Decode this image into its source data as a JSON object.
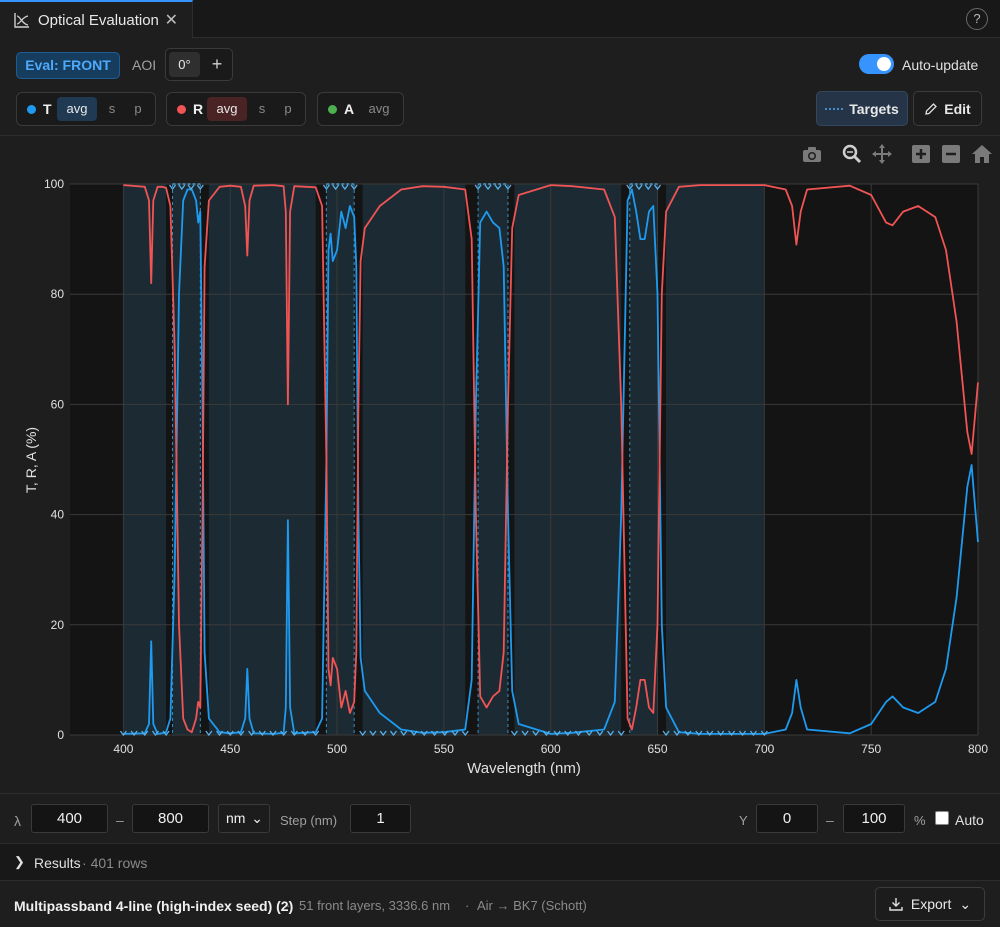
{
  "tab": {
    "title": "Optical Evaluation",
    "close_label": "✕",
    "help_label": "?"
  },
  "toolbar": {
    "eval_label": "Eval: FRONT",
    "aoi_label": "AOI",
    "aoi_value": "0°",
    "aoi_add": "+",
    "auto_update_label": "Auto-update",
    "auto_update_on": true,
    "targets_label": "Targets",
    "edit_label": "Edit"
  },
  "series_groups": [
    {
      "name": "T",
      "color": "#1e9bf0",
      "options": [
        "avg",
        "s",
        "p"
      ],
      "selected": "avg"
    },
    {
      "name": "R",
      "color": "#f05454",
      "options": [
        "avg",
        "s",
        "p"
      ],
      "selected": "avg"
    },
    {
      "name": "A",
      "color": "#4caf50",
      "options": [
        "avg"
      ],
      "selected": "avg"
    }
  ],
  "modebar": [
    "camera-icon",
    "zoom-icon",
    "pan-icon",
    "zoom-in-icon",
    "zoom-out-icon",
    "home-icon"
  ],
  "chart_data": {
    "type": "line",
    "xlabel": "Wavelength (nm)",
    "ylabel": "T, R, A (%)",
    "xlim": [
      375,
      800
    ],
    "ylim": [
      0,
      100
    ],
    "xticks": [
      400,
      450,
      500,
      550,
      600,
      650,
      700,
      750,
      800
    ],
    "yticks": [
      0,
      20,
      40,
      60,
      80,
      100
    ],
    "grid": true,
    "target_regions": [
      {
        "x0": 400,
        "x1": 420,
        "type": "stop"
      },
      {
        "x0": 423,
        "x1": 436,
        "type": "pass"
      },
      {
        "x0": 440,
        "x1": 490,
        "type": "stop"
      },
      {
        "x0": 495,
        "x1": 508,
        "type": "pass"
      },
      {
        "x0": 512,
        "x1": 560,
        "type": "stop"
      },
      {
        "x0": 566,
        "x1": 580,
        "type": "pass"
      },
      {
        "x0": 583,
        "x1": 633,
        "type": "stop"
      },
      {
        "x0": 637,
        "x1": 650,
        "type": "pass"
      },
      {
        "x0": 654,
        "x1": 700,
        "type": "stop"
      }
    ],
    "series": [
      {
        "name": "T",
        "color": "#1e9bf0",
        "points": [
          [
            400,
            0.2
          ],
          [
            410,
            0.3
          ],
          [
            412,
            2
          ],
          [
            413,
            17
          ],
          [
            414,
            2
          ],
          [
            416,
            0.2
          ],
          [
            418,
            0.3
          ],
          [
            420,
            0.5
          ],
          [
            422,
            3
          ],
          [
            424,
            30
          ],
          [
            426,
            80
          ],
          [
            428,
            97
          ],
          [
            430,
            99
          ],
          [
            432,
            99
          ],
          [
            434,
            97
          ],
          [
            435,
            93
          ],
          [
            436,
            95
          ],
          [
            437,
            60
          ],
          [
            438,
            15
          ],
          [
            440,
            3
          ],
          [
            445,
            0.5
          ],
          [
            450,
            0.3
          ],
          [
            455,
            0.5
          ],
          [
            457,
            3
          ],
          [
            458,
            12
          ],
          [
            459,
            3
          ],
          [
            461,
            0.3
          ],
          [
            470,
            0.2
          ],
          [
            475,
            0.4
          ],
          [
            476,
            5
          ],
          [
            477,
            39
          ],
          [
            478,
            5
          ],
          [
            480,
            0.3
          ],
          [
            490,
            0.5
          ],
          [
            493,
            3
          ],
          [
            495,
            50
          ],
          [
            496,
            88
          ],
          [
            497,
            91
          ],
          [
            498,
            86
          ],
          [
            500,
            88
          ],
          [
            502,
            95
          ],
          [
            504,
            92
          ],
          [
            506,
            96
          ],
          [
            508,
            94
          ],
          [
            509,
            85
          ],
          [
            510,
            40
          ],
          [
            511,
            14
          ],
          [
            513,
            8
          ],
          [
            520,
            4
          ],
          [
            530,
            1
          ],
          [
            540,
            0.4
          ],
          [
            550,
            0.5
          ],
          [
            560,
            1
          ],
          [
            563,
            10
          ],
          [
            565,
            60
          ],
          [
            567,
            93
          ],
          [
            570,
            95
          ],
          [
            573,
            93
          ],
          [
            576,
            92
          ],
          [
            578,
            85
          ],
          [
            580,
            40
          ],
          [
            582,
            8
          ],
          [
            585,
            2
          ],
          [
            600,
            0.2
          ],
          [
            610,
            0.4
          ],
          [
            625,
            1
          ],
          [
            630,
            6
          ],
          [
            633,
            40
          ],
          [
            636,
            97
          ],
          [
            638,
            99
          ],
          [
            640,
            95
          ],
          [
            642,
            90
          ],
          [
            644,
            90
          ],
          [
            646,
            95
          ],
          [
            648,
            96
          ],
          [
            650,
            80
          ],
          [
            652,
            20
          ],
          [
            654,
            5
          ],
          [
            660,
            0.5
          ],
          [
            670,
            0.2
          ],
          [
            700,
            0.2
          ],
          [
            710,
            1
          ],
          [
            713,
            4
          ],
          [
            715,
            10
          ],
          [
            717,
            5
          ],
          [
            720,
            1
          ],
          [
            740,
            0.3
          ],
          [
            750,
            2
          ],
          [
            757,
            6
          ],
          [
            760,
            7
          ],
          [
            765,
            5
          ],
          [
            772,
            4
          ],
          [
            780,
            6
          ],
          [
            785,
            12
          ],
          [
            790,
            25
          ],
          [
            795,
            45
          ],
          [
            797,
            49
          ],
          [
            800,
            35
          ]
        ]
      },
      {
        "name": "R",
        "color": "#f05454",
        "points": [
          [
            400,
            99.8
          ],
          [
            410,
            99.5
          ],
          [
            412,
            97
          ],
          [
            413,
            82
          ],
          [
            414,
            97
          ],
          [
            416,
            99.5
          ],
          [
            418,
            99.5
          ],
          [
            420,
            99.3
          ],
          [
            422,
            96
          ],
          [
            424,
            70
          ],
          [
            426,
            20
          ],
          [
            428,
            3
          ],
          [
            430,
            1
          ],
          [
            432,
            0.5
          ],
          [
            434,
            3
          ],
          [
            435,
            6
          ],
          [
            436,
            5
          ],
          [
            437,
            40
          ],
          [
            438,
            85
          ],
          [
            440,
            97
          ],
          [
            445,
            99.5
          ],
          [
            450,
            99.7
          ],
          [
            455,
            99.5
          ],
          [
            457,
            96
          ],
          [
            458,
            87
          ],
          [
            459,
            97
          ],
          [
            461,
            99.7
          ],
          [
            470,
            99.8
          ],
          [
            475,
            99.6
          ],
          [
            476,
            95
          ],
          [
            477,
            60
          ],
          [
            478,
            95
          ],
          [
            480,
            99.6
          ],
          [
            490,
            99.4
          ],
          [
            493,
            96
          ],
          [
            495,
            50
          ],
          [
            496,
            12
          ],
          [
            497,
            9
          ],
          [
            498,
            14
          ],
          [
            500,
            12
          ],
          [
            502,
            5
          ],
          [
            504,
            8
          ],
          [
            506,
            4
          ],
          [
            508,
            6
          ],
          [
            509,
            15
          ],
          [
            510,
            60
          ],
          [
            511,
            86
          ],
          [
            513,
            92
          ],
          [
            520,
            96
          ],
          [
            530,
            99
          ],
          [
            540,
            99.6
          ],
          [
            550,
            99.5
          ],
          [
            560,
            99
          ],
          [
            563,
            90
          ],
          [
            565,
            40
          ],
          [
            567,
            7
          ],
          [
            570,
            5
          ],
          [
            573,
            7
          ],
          [
            576,
            8
          ],
          [
            578,
            15
          ],
          [
            580,
            60
          ],
          [
            582,
            92
          ],
          [
            585,
            98
          ],
          [
            600,
            99.8
          ],
          [
            610,
            99.6
          ],
          [
            625,
            99
          ],
          [
            630,
            94
          ],
          [
            633,
            60
          ],
          [
            636,
            3
          ],
          [
            638,
            1
          ],
          [
            640,
            5
          ],
          [
            642,
            10
          ],
          [
            644,
            10
          ],
          [
            646,
            5
          ],
          [
            648,
            4
          ],
          [
            650,
            20
          ],
          [
            652,
            80
          ],
          [
            654,
            95
          ],
          [
            660,
            99.5
          ],
          [
            670,
            99.8
          ],
          [
            700,
            99.8
          ],
          [
            710,
            99
          ],
          [
            713,
            96
          ],
          [
            715,
            89
          ],
          [
            717,
            95
          ],
          [
            720,
            99
          ],
          [
            740,
            99.7
          ],
          [
            750,
            98
          ],
          [
            757,
            93
          ],
          [
            760,
            92.5
          ],
          [
            765,
            95
          ],
          [
            772,
            96
          ],
          [
            780,
            94
          ],
          [
            785,
            88
          ],
          [
            790,
            75
          ],
          [
            795,
            55
          ],
          [
            797,
            51
          ],
          [
            800,
            64
          ]
        ]
      }
    ]
  },
  "range": {
    "lambda_label": "λ",
    "min": "400",
    "max": "800",
    "unit": "nm",
    "step_label": "Step (nm)",
    "step": "1",
    "y_label": "Y",
    "y_min": "0",
    "y_max": "100",
    "y_unit": "%",
    "auto_label": "Auto",
    "auto_checked": false
  },
  "results": {
    "label": "Results",
    "count": "401 rows"
  },
  "footer": {
    "design_name": "Multipassband 4-line (high-index seed) (2)",
    "layers": "51 front layers, 3336.6 nm",
    "media": "Air → BK7 (Schott)",
    "export_label": "Export"
  }
}
